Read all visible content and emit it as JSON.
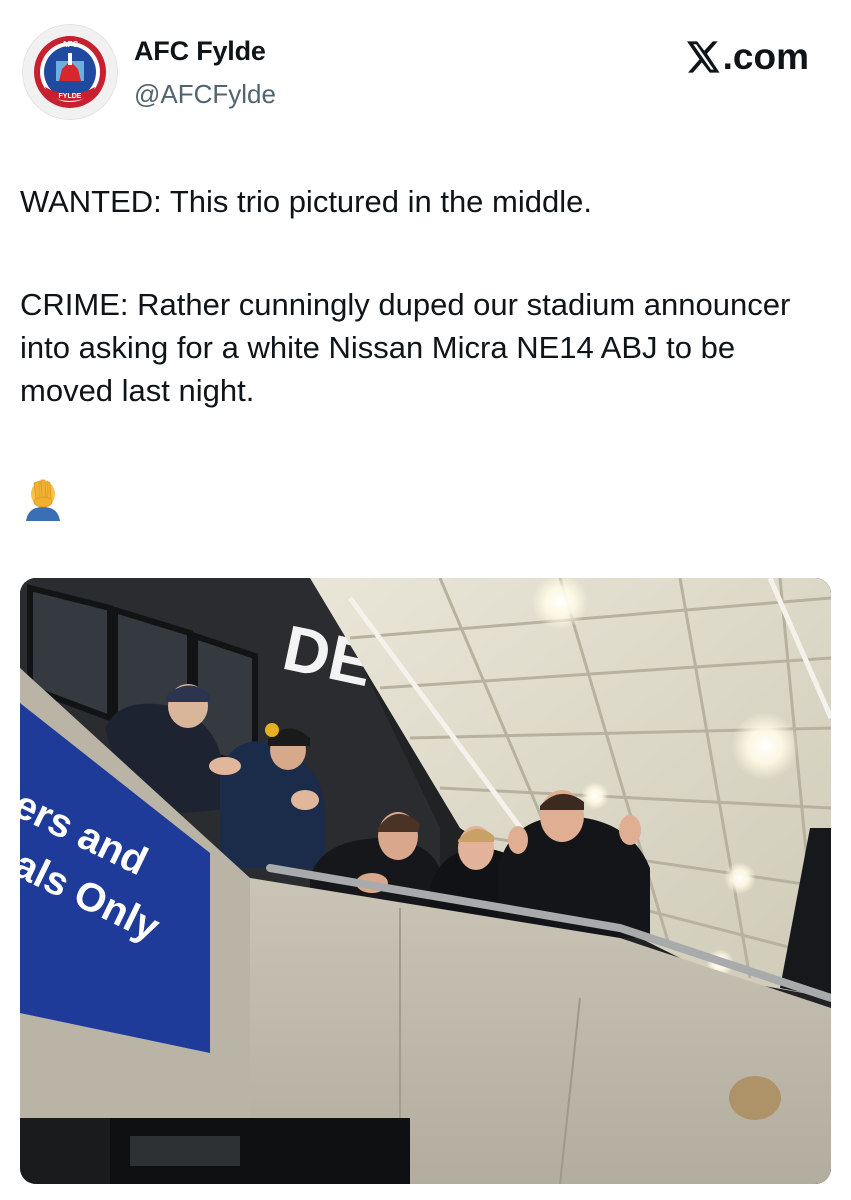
{
  "account": {
    "name": "AFC Fylde",
    "handle": "@AFCFylde",
    "avatar_label": "AFC FYLDE crest",
    "brand": ".com",
    "brand_icon": "x-logo-icon"
  },
  "post": {
    "line1": "WANTED: This trio pictured in the middle.",
    "line2": "CRIME: Rather cunningly duped our stadium announcer into asking for a white Nissan Micra NE14 ABJ to be moved last night.",
    "emoji": "🤦‍♂️"
  },
  "photo": {
    "sign_line1": "ers and",
    "sign_line2": "als Only",
    "stand_letters": "DE"
  },
  "colors": {
    "text": "#0f1419",
    "secondary": "#536471",
    "sign_blue": "#1f3b9a"
  }
}
